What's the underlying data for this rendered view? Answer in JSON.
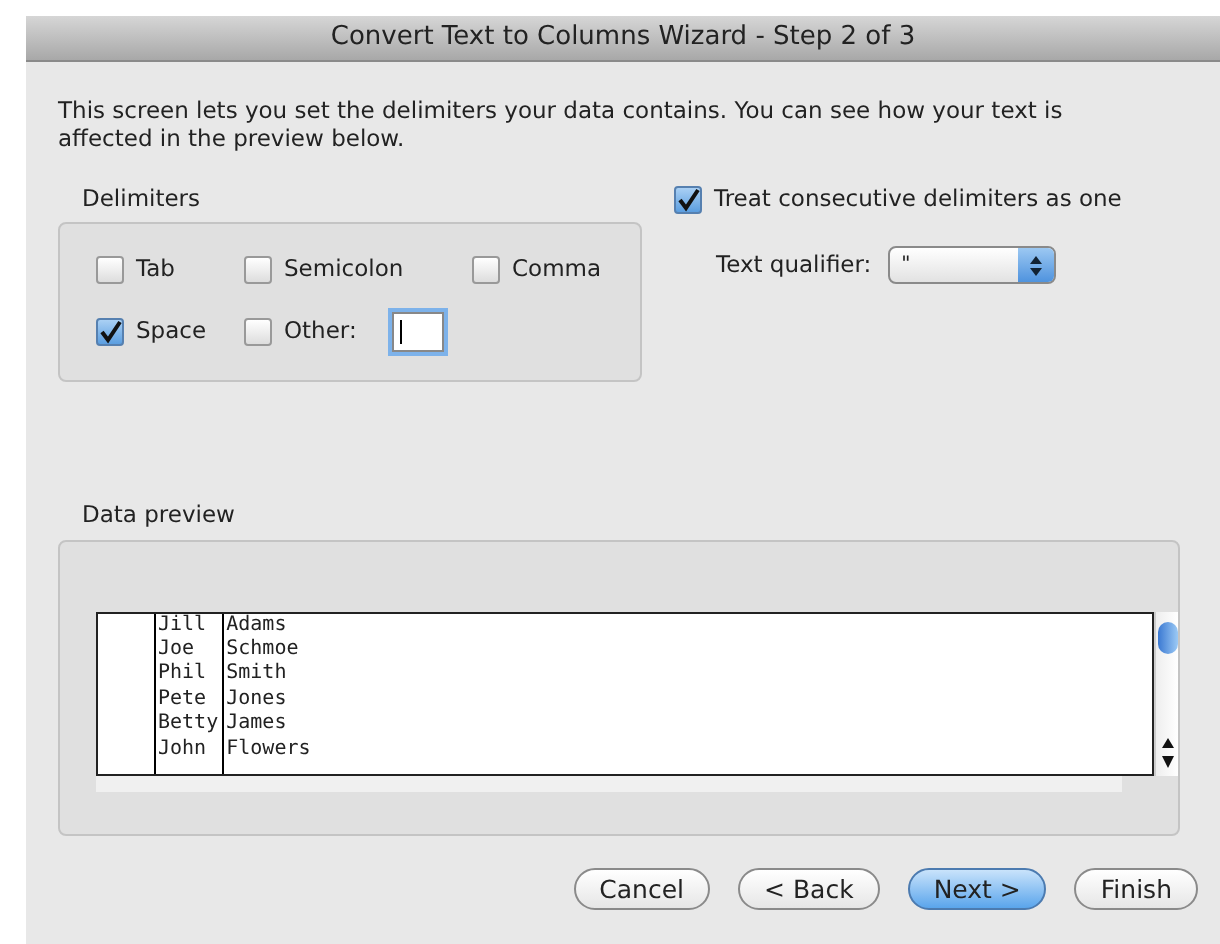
{
  "window": {
    "title": "Convert Text to Columns Wizard - Step 2 of 3"
  },
  "description": "This screen lets you set the delimiters your data contains.  You can see how your text is affected in the preview below.",
  "delimiters": {
    "label": "Delimiters",
    "options": [
      {
        "label": "Tab",
        "checked": false
      },
      {
        "label": "Semicolon",
        "checked": false
      },
      {
        "label": "Comma",
        "checked": false
      },
      {
        "label": "Space",
        "checked": true
      },
      {
        "label": "Other:",
        "checked": false
      }
    ],
    "other_field": {
      "focused": true
    }
  },
  "treat_consecutive": {
    "label": "Treat consecutive delimiters as one",
    "checked": true
  },
  "text_qualifier": {
    "label": "Text qualifier:",
    "value": "\""
  },
  "data_preview": {
    "label": "Data preview",
    "rows": [
      {
        "cells": [
          "Jill",
          "Adams"
        ]
      },
      {
        "cells": [
          "Joe",
          "Schmoe"
        ]
      },
      {
        "cells": [
          "Phil",
          "Smith"
        ]
      },
      {
        "cells": [
          "Pete",
          "Jones"
        ]
      },
      {
        "cells": [
          "Betty",
          "James"
        ]
      },
      {
        "cells": [
          "John",
          "Flowers"
        ]
      }
    ]
  },
  "buttons": [
    {
      "label": "Cancel",
      "default": false
    },
    {
      "label": "< Back",
      "default": false
    },
    {
      "label": "Next >",
      "default": true
    },
    {
      "label": "Finish",
      "default": false
    }
  ]
}
